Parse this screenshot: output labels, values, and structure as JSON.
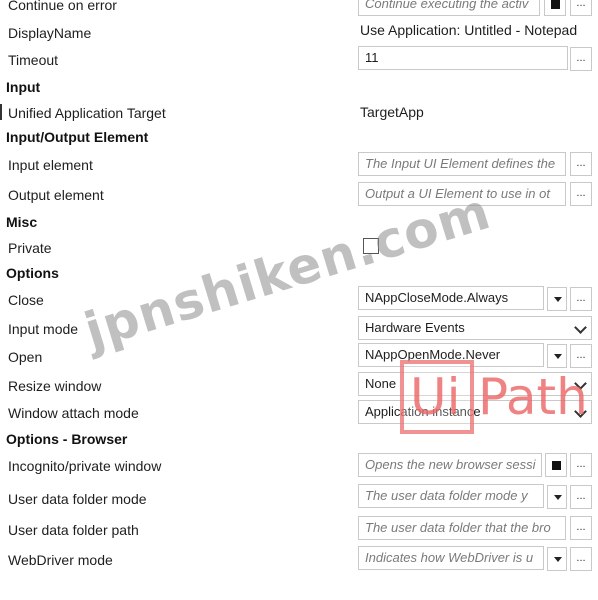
{
  "rows": {
    "continue_on_error": {
      "label": "Continue on error",
      "placeholder": "Continue executing the activ"
    },
    "display_name": {
      "label": "DisplayName",
      "value": "Use Application: Untitled - Notepad"
    },
    "timeout": {
      "label": "Timeout",
      "value": "11"
    },
    "input_section": "Input",
    "unified_target": {
      "label": "Unified Application Target",
      "value": "TargetApp"
    },
    "io_section": "Input/Output Element",
    "input_element": {
      "label": "Input element",
      "placeholder": "The Input UI Element defines the"
    },
    "output_element": {
      "label": "Output element",
      "placeholder": "Output a UI Element to use in ot"
    },
    "misc_section": "Misc",
    "private": {
      "label": "Private"
    },
    "options_section": "Options",
    "close": {
      "label": "Close",
      "value": "NAppCloseMode.Always"
    },
    "input_mode": {
      "label": "Input mode",
      "value": "Hardware Events"
    },
    "open": {
      "label": "Open",
      "value": "NAppOpenMode.Never"
    },
    "resize_window": {
      "label": "Resize window",
      "value": "None"
    },
    "window_attach": {
      "label": "Window attach mode",
      "value": "Application instance"
    },
    "browser_section": "Options - Browser",
    "incognito": {
      "label": "Incognito/private window",
      "placeholder": "Opens the new browser sessi"
    },
    "user_data_mode": {
      "label": "User data folder mode",
      "placeholder": "The user data folder mode y"
    },
    "user_data_path": {
      "label": "User data folder path",
      "placeholder": "The user data folder that the bro"
    },
    "webdriver": {
      "label": "WebDriver mode",
      "placeholder": "Indicates how WebDriver is u"
    }
  },
  "buttons": {
    "ellipsis": "..."
  },
  "watermark": {
    "text": "jpnshiken.com"
  },
  "logo": {
    "box_text": "Ui",
    "text": "Path",
    "color": "#eb6464"
  },
  "icons": [
    "ellipsis-icon",
    "dropdown-caret-icon",
    "chevron-down-icon",
    "checkbox-icon",
    "expression-square-icon"
  ]
}
